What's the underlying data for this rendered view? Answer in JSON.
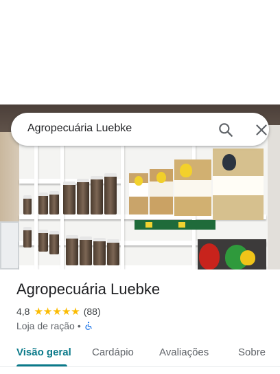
{
  "search": {
    "query": "Agropecuária Luebke",
    "search_icon": "search-icon",
    "close_icon": "close-icon"
  },
  "place": {
    "name": "Agropecuária Luebke",
    "rating": "4,8",
    "stars_value": 4.8,
    "review_count": "(88)",
    "category": "Loja de ração",
    "separator": "•",
    "accessibility_icon": "wheelchair-icon"
  },
  "tabs": [
    {
      "label": "Visão geral",
      "active": true
    },
    {
      "label": "Cardápio",
      "active": false
    },
    {
      "label": "Avaliações",
      "active": false
    },
    {
      "label": "Sobre",
      "active": false
    }
  ],
  "colors": {
    "accent": "#0b7a8a",
    "star": "#fbbc04",
    "accessibility_icon": "#1a73e8"
  }
}
